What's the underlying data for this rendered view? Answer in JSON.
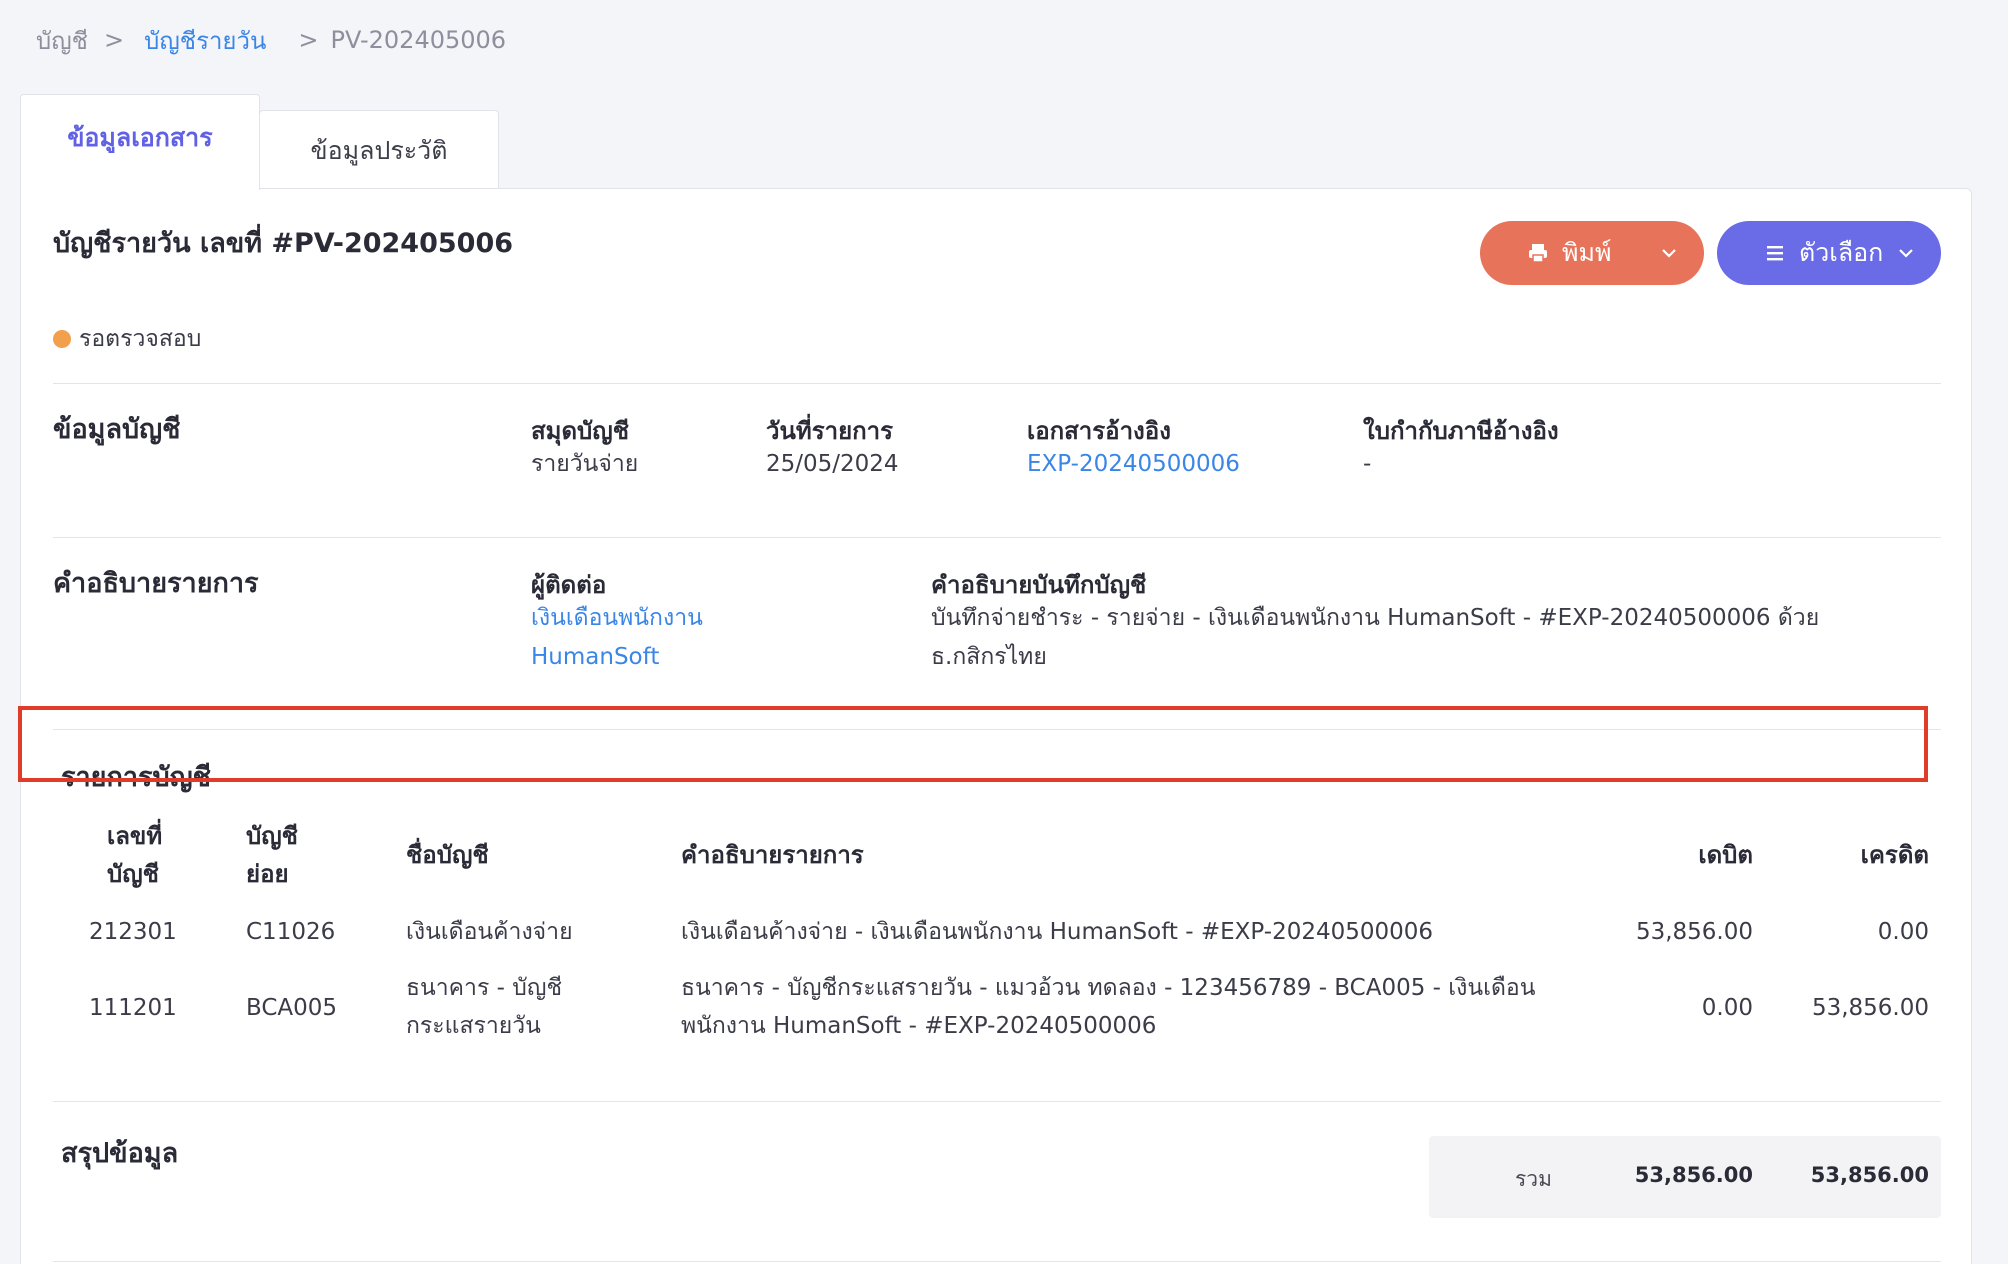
{
  "breadcrumb": {
    "root": "บัญชี",
    "parent": "บัญชีรายวัน",
    "current": "PV-202405006",
    "separator": ">"
  },
  "tabs": [
    {
      "label": "ข้อมูลเอกสาร",
      "active": true
    },
    {
      "label": "ข้อมูลประวัติ",
      "active": false
    }
  ],
  "document": {
    "title": "บัญชีรายวัน เลขที่ #PV-202405006",
    "status": "รอตรวจสอบ",
    "status_color": "#f2a04e"
  },
  "actions": {
    "print_label": "พิมพ์",
    "options_label": "ตัวเลือก",
    "print_color": "#e8735b",
    "options_color": "#6a6be7"
  },
  "account_info": {
    "section_title": "ข้อมูลบัญชี",
    "book_label": "สมุดบัญชี",
    "book_value": "รายวันจ่าย",
    "date_label": "วันที่รายการ",
    "date_value": "25/05/2024",
    "ref_doc_label": "เอกสารอ้างอิง",
    "ref_doc_value": "EXP-20240500006",
    "tax_invoice_label": "ใบกำกับภาษีอ้างอิง",
    "tax_invoice_value": "-"
  },
  "description": {
    "section_title": "คำอธิบายรายการ",
    "contact_label": "ผู้ติดต่อ",
    "contact_line1": "เงินเดือนพนักงาน",
    "contact_line2": "HumanSoft",
    "memo_label": "คำอธิบายบันทึกบัญชี",
    "memo_line1": "บันทึกจ่ายชำระ - รายจ่าย - เงินเดือนพนักงาน HumanSoft - #EXP-20240500006 ด้วย",
    "memo_line2": "ธ.กสิกรไทย"
  },
  "entries": {
    "section_title": "รายการบัญชี",
    "headers": {
      "account_no_1": "เลขที่",
      "account_no_2": "บัญชี",
      "sub_account_1": "บัญชี",
      "sub_account_2": "ย่อย",
      "account_name": "ชื่อบัญชี",
      "description": "คำอธิบายรายการ",
      "debit": "เดบิต",
      "credit": "เครดิต"
    },
    "rows": [
      {
        "account_no": "212301",
        "sub_account": "C11026",
        "account_name_1": "เงินเดือนค้างจ่าย",
        "account_name_2": "",
        "description_1": "เงินเดือนค้างจ่าย - เงินเดือนพนักงาน HumanSoft - #EXP-20240500006",
        "description_2": "",
        "debit": "53,856.00",
        "credit": "0.00"
      },
      {
        "account_no": "111201",
        "sub_account": "BCA005",
        "account_name_1": "ธนาคาร - บัญชี",
        "account_name_2": "กระแสรายวัน",
        "description_1": "ธนาคาร - บัญชีกระแสรายวัน - แมวอ้วน ทดลอง - 123456789 - BCA005 - เงินเดือน",
        "description_2": "พนักงาน HumanSoft - #EXP-20240500006",
        "debit": "0.00",
        "credit": "53,856.00"
      }
    ]
  },
  "summary": {
    "section_title": "สรุปข้อมูล",
    "total_label": "รวม",
    "total_debit": "53,856.00",
    "total_credit": "53,856.00"
  },
  "highlight_color": "#e03c2a"
}
